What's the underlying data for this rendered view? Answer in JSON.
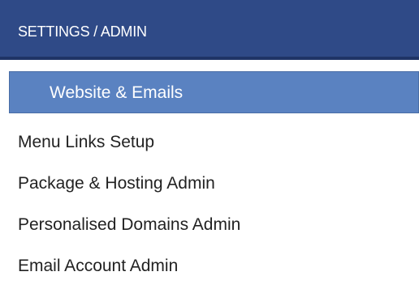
{
  "header": {
    "title": "SETTINGS / ADMIN"
  },
  "active_item": {
    "label": "Website & Emails"
  },
  "menu": {
    "items": [
      {
        "label": "Menu Links Setup"
      },
      {
        "label": "Package & Hosting Admin"
      },
      {
        "label": "Personalised Domains Admin"
      },
      {
        "label": "Email Account Admin"
      }
    ]
  },
  "colors": {
    "header_bg": "#2f4a87",
    "active_bg": "#5a82c1",
    "text": "#222222"
  }
}
